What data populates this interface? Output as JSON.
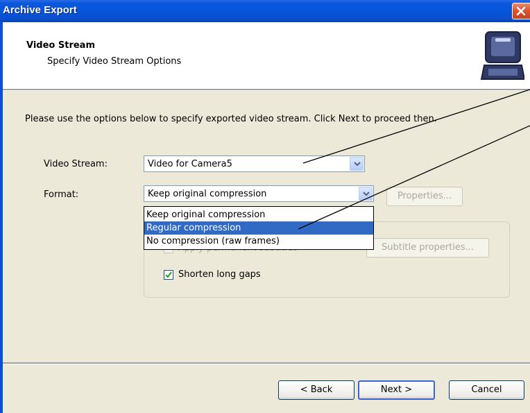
{
  "window": {
    "title": "Archive Export"
  },
  "header": {
    "title": "Video Stream",
    "subtitle": "Specify Video Stream Options"
  },
  "instruction": "Please use the options below to specify exported video stream. Click Next to proceed then.",
  "video_stream": {
    "label": "Video Stream:",
    "value": "Video for Camera5"
  },
  "format": {
    "label": "Format:",
    "value": "Keep original compression",
    "properties_label": "Properties...",
    "options": [
      "Keep original compression",
      "Regular compression",
      "No compression (raw frames)"
    ],
    "highlighted_index": 1
  },
  "subtitles": {
    "checkbox_label": "Apply permanent subtitles",
    "properties_label": "Subtitle properties..."
  },
  "shorten_gaps": {
    "label": "Shorten long gaps",
    "checked": true
  },
  "footer": {
    "back_label": "< Back",
    "next_label": "Next >",
    "cancel_label": "Cancel"
  },
  "icons": {
    "close": "close-icon",
    "header": "laptop-icon",
    "dropdown": "chevron-down-icon",
    "check": "checkmark-icon"
  }
}
